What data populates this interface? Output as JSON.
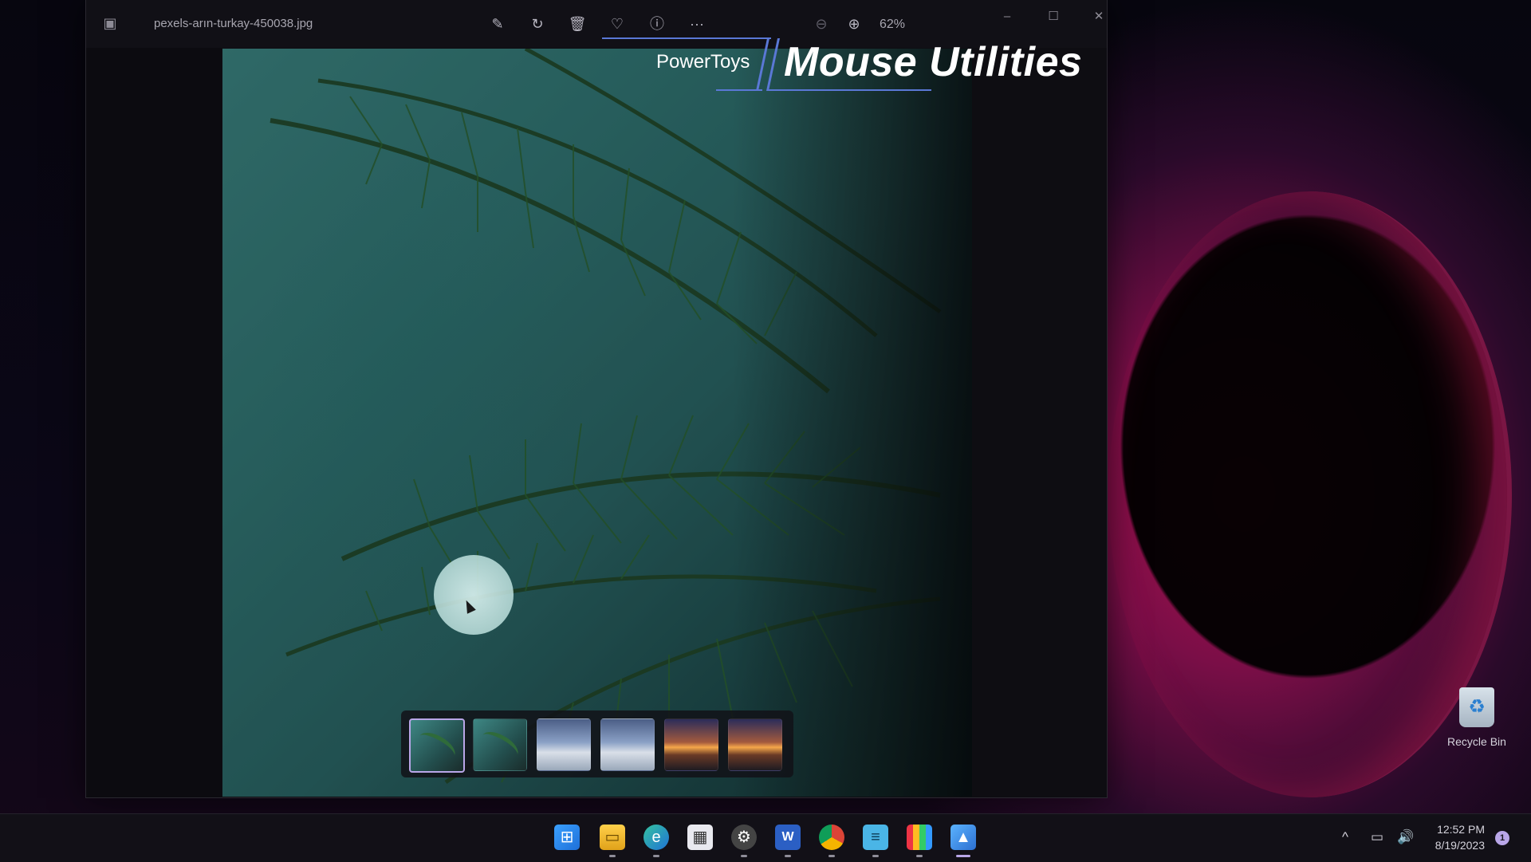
{
  "window": {
    "file_name": "pexels-arın-turkay-450038.jpg",
    "zoom_level": "62%",
    "toolbar_icons": [
      "edit-icon",
      "rotate-icon",
      "delete-icon",
      "favorite-icon",
      "info-icon",
      "more-icon",
      "zoom-out-icon",
      "zoom-in-icon"
    ],
    "controls": {
      "minimize": "–",
      "maximize": "☐",
      "close": "✕"
    }
  },
  "overlay": {
    "brand": "PowerToys",
    "title": "Mouse Utilities",
    "accent_color": "#5a78d6"
  },
  "filmstrip": {
    "thumbnails": [
      {
        "kind": "palm",
        "selected": true
      },
      {
        "kind": "palm",
        "selected": false
      },
      {
        "kind": "city",
        "selected": false
      },
      {
        "kind": "city",
        "selected": false
      },
      {
        "kind": "sunset",
        "selected": false
      },
      {
        "kind": "sunset",
        "selected": false
      }
    ]
  },
  "desktop": {
    "recycle_bin_label": "Recycle Bin"
  },
  "taskbar": {
    "apps": [
      "start-icon",
      "file-explorer-icon",
      "edge-icon",
      "store-icon",
      "settings-icon",
      "word-icon",
      "chrome-icon",
      "notepad-icon",
      "powertoys-icon",
      "photos-icon"
    ],
    "clock_time": "12:52 PM",
    "clock_date": "8/19/2023",
    "notification_count": "1"
  }
}
